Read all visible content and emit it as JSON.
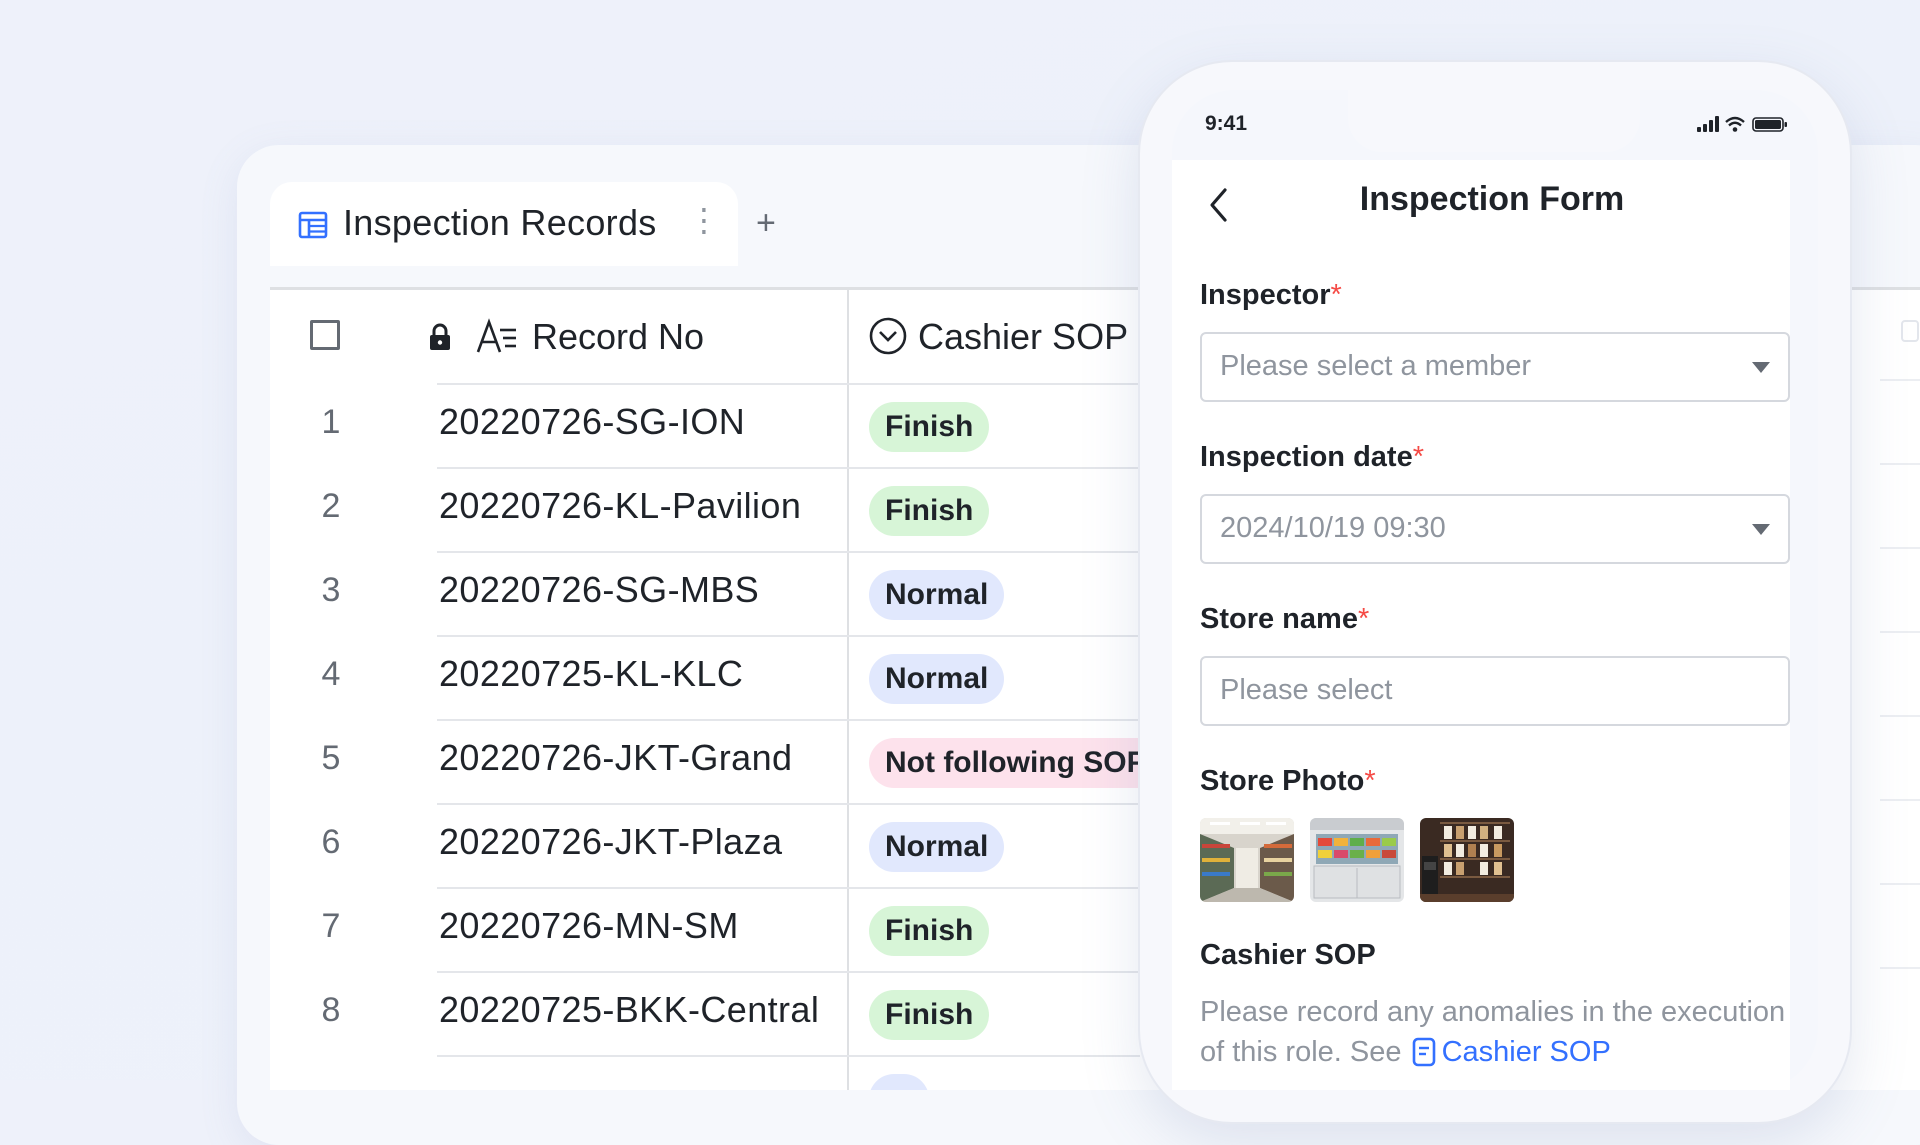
{
  "table": {
    "tab_title": "Inspection Records",
    "tab_more": "⋮",
    "tab_add": "+",
    "columns": [
      {
        "label": "Record No",
        "icon": "text-field-icon"
      },
      {
        "label": "Cashier SOP",
        "icon": "single-select-icon"
      }
    ],
    "rows": [
      {
        "num": "1",
        "record": "20220726-SG-ION",
        "status": "Finish",
        "kind": "finish"
      },
      {
        "num": "2",
        "record": "20220726-KL-Pavilion",
        "status": "Finish",
        "kind": "finish"
      },
      {
        "num": "3",
        "record": "20220726-SG-MBS",
        "status": "Normal",
        "kind": "normal"
      },
      {
        "num": "4",
        "record": "20220725-KL-KLC",
        "status": "Normal",
        "kind": "normal"
      },
      {
        "num": "5",
        "record": "20220726-JKT-Grand",
        "status": "Not following SOP",
        "kind": "notfollow"
      },
      {
        "num": "6",
        "record": "20220726-JKT-Plaza",
        "status": "Normal",
        "kind": "normal"
      },
      {
        "num": "7",
        "record": "20220726-MN-SM",
        "status": "Finish",
        "kind": "finish"
      },
      {
        "num": "8",
        "record": "20220725-BKK-Central",
        "status": "Finish",
        "kind": "finish"
      }
    ],
    "colors": {
      "finish": "#d7f5d7",
      "normal": "#e1e8fd",
      "notfollow": "#fde2ec"
    }
  },
  "phone": {
    "time": "9:41",
    "title": "Inspection Form",
    "fields": {
      "inspector": {
        "label": "Inspector",
        "required": "*",
        "placeholder": "Please select a member"
      },
      "date": {
        "label": "Inspection date",
        "required": "*",
        "value": "2024/10/19 09:30"
      },
      "store": {
        "label": "Store name",
        "required": "*",
        "placeholder": "Please select"
      },
      "photo": {
        "label": "Store Photo",
        "required": "*"
      },
      "sop": {
        "label": "Cashier SOP",
        "desc": "Please record any anomalies in the execution of this role. See",
        "link": "Cashier SOP"
      }
    },
    "accent": "#3370ff",
    "required_color": "#f54a45"
  }
}
